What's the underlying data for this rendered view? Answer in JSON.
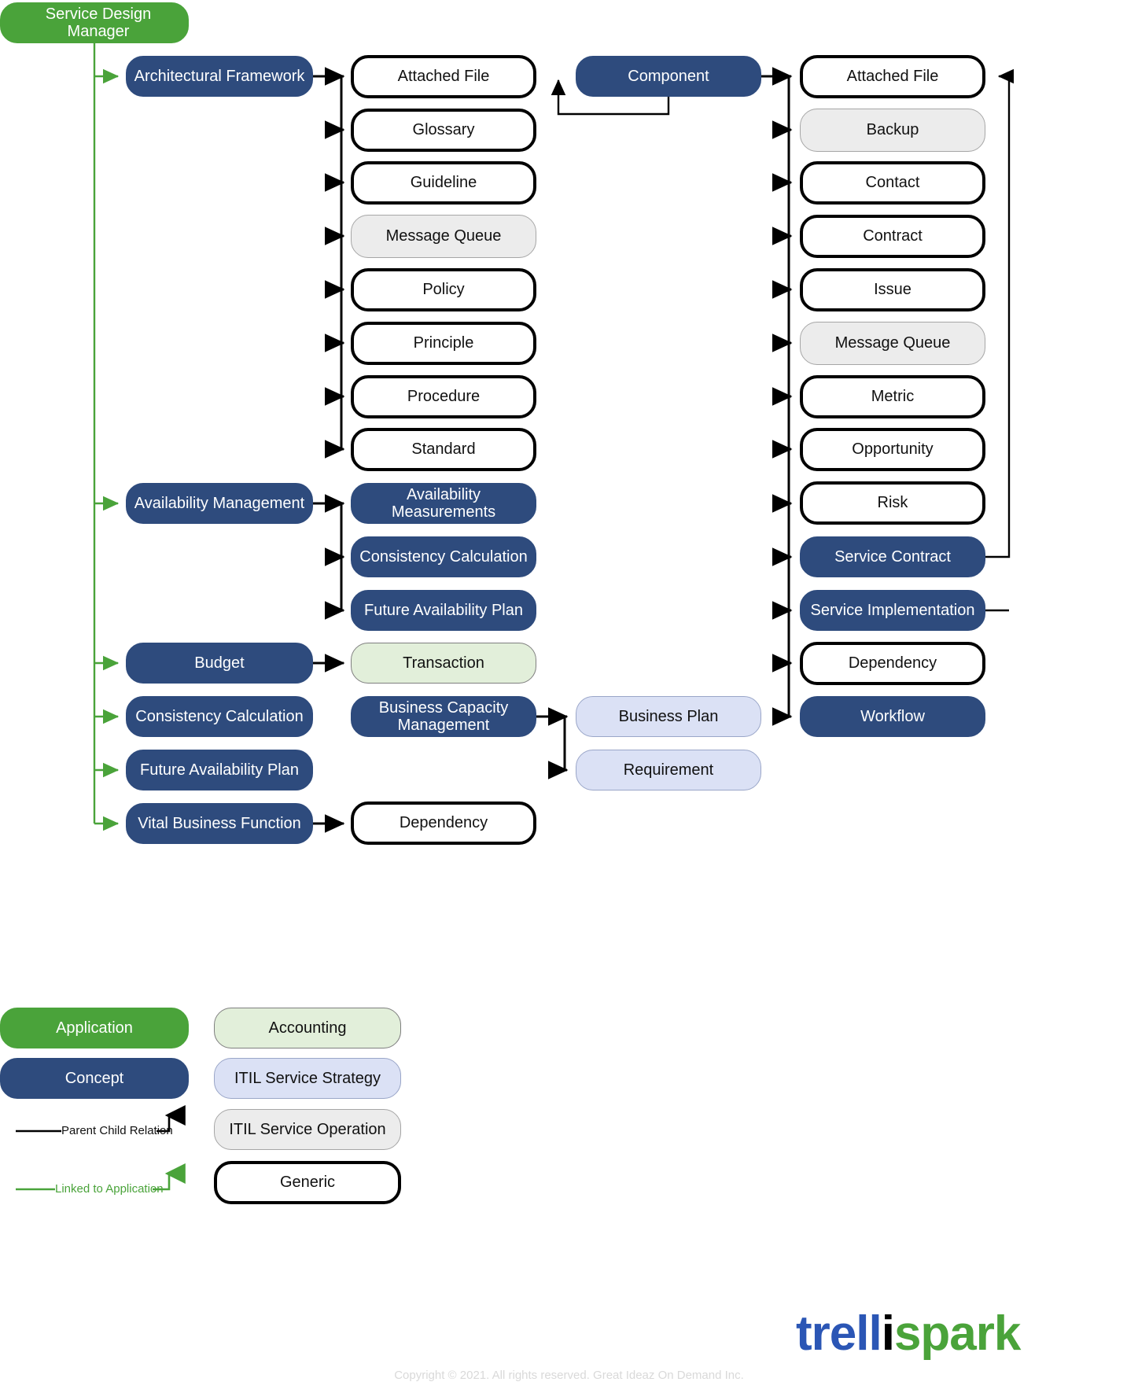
{
  "diagram": {
    "root": {
      "label": "Service Design Manager",
      "type": "application"
    },
    "level1": [
      {
        "label": "Architectural Framework",
        "type": "concept"
      },
      {
        "label": "Availability Management",
        "type": "concept"
      },
      {
        "label": "Budget",
        "type": "concept"
      },
      {
        "label": "Consistency Calculation",
        "type": "concept"
      },
      {
        "label": "Future Availability Plan",
        "type": "concept"
      },
      {
        "label": "Vital Business Function",
        "type": "concept"
      }
    ],
    "architectural_framework_children": [
      {
        "label": "Attached File",
        "type": "generic"
      },
      {
        "label": "Glossary",
        "type": "generic"
      },
      {
        "label": "Guideline",
        "type": "generic"
      },
      {
        "label": "Message Queue",
        "type": "operation"
      },
      {
        "label": "Policy",
        "type": "generic"
      },
      {
        "label": "Principle",
        "type": "generic"
      },
      {
        "label": "Procedure",
        "type": "generic"
      },
      {
        "label": "Standard",
        "type": "generic"
      }
    ],
    "availability_management_children": [
      {
        "label": "Availability\nMeasurements",
        "type": "concept"
      },
      {
        "label": "Consistency Calculation",
        "type": "concept"
      },
      {
        "label": "Future Availability Plan",
        "type": "concept"
      }
    ],
    "budget_children": [
      {
        "label": "Transaction",
        "type": "accounting"
      }
    ],
    "business_capacity": {
      "label": "Business Capacity\nManagement",
      "type": "concept"
    },
    "business_capacity_children": [
      {
        "label": "Business Plan",
        "type": "strategy"
      },
      {
        "label": "Requirement",
        "type": "strategy"
      }
    ],
    "vital_business_function_children": [
      {
        "label": "Dependency",
        "type": "generic"
      }
    ],
    "component": {
      "label": "Component",
      "type": "concept"
    },
    "component_children": [
      {
        "label": "Attached File",
        "type": "generic"
      },
      {
        "label": "Backup",
        "type": "operation"
      },
      {
        "label": "Contact",
        "type": "generic"
      },
      {
        "label": "Contract",
        "type": "generic"
      },
      {
        "label": "Issue",
        "type": "generic"
      },
      {
        "label": "Message Queue",
        "type": "operation"
      },
      {
        "label": "Metric",
        "type": "generic"
      },
      {
        "label": "Opportunity",
        "type": "generic"
      },
      {
        "label": "Risk",
        "type": "generic"
      },
      {
        "label": "Service Contract",
        "type": "concept"
      },
      {
        "label": "Service Implementation",
        "type": "concept"
      },
      {
        "label": "Dependency",
        "type": "generic"
      },
      {
        "label": "Workflow",
        "type": "concept"
      }
    ]
  },
  "legend": {
    "shapes_left": [
      {
        "label": "Application",
        "type": "application"
      },
      {
        "label": "Concept",
        "type": "concept"
      }
    ],
    "shapes_right": [
      {
        "label": "Accounting",
        "type": "accounting"
      },
      {
        "label": "ITIL Service Strategy",
        "type": "strategy"
      },
      {
        "label": "ITIL Service Operation",
        "type": "operation"
      },
      {
        "label": "Generic",
        "type": "generic"
      }
    ],
    "relations": [
      {
        "label": "Parent Child Relation",
        "color": "#000000"
      },
      {
        "label": "Linked to Application",
        "color": "#4aa33a"
      }
    ]
  },
  "branding": {
    "logo_part1": "trell",
    "logo_part2": "i",
    "logo_part3": "spark",
    "copyright": "Copyright © 2021. All rights reserved. Great Ideaz On Demand Inc."
  },
  "colors": {
    "application": "#4aa33a",
    "concept": "#2e4b7d",
    "accounting": "#e2efda",
    "strategy": "#dbe1f5",
    "operation": "#ececec",
    "generic": "#ffffff",
    "link_green": "#4aa33a",
    "link_black": "#000000",
    "logo_blue": "#2b56b5",
    "logo_green": "#4aa33a"
  }
}
